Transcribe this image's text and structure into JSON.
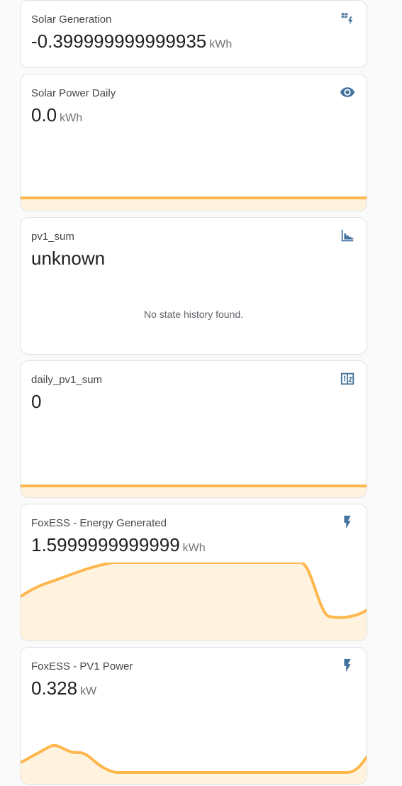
{
  "accent_color": "#ffb74d",
  "icon_color": "#44739e",
  "cards": [
    {
      "name": "Solar Generation",
      "value": "-0.399999999999935",
      "unit": "kWh",
      "icon": "solar-power-icon"
    },
    {
      "name": "Solar Power Daily",
      "value": "0.0",
      "unit": "kWh",
      "icon": "eye-icon"
    },
    {
      "name": "pv1_sum",
      "value": "unknown",
      "unit": "",
      "icon": "chart-histogram-icon",
      "empty_message": "No state history found."
    },
    {
      "name": "daily_pv1_sum",
      "value": "0",
      "unit": "",
      "icon": "counter-icon"
    },
    {
      "name": "FoxESS - Energy Generated",
      "value": "1.5999999999999",
      "unit": "kWh",
      "icon": "flash-icon"
    },
    {
      "name": "FoxESS - PV1 Power",
      "value": "0.328",
      "unit": "kW",
      "icon": "flash-icon"
    }
  ]
}
